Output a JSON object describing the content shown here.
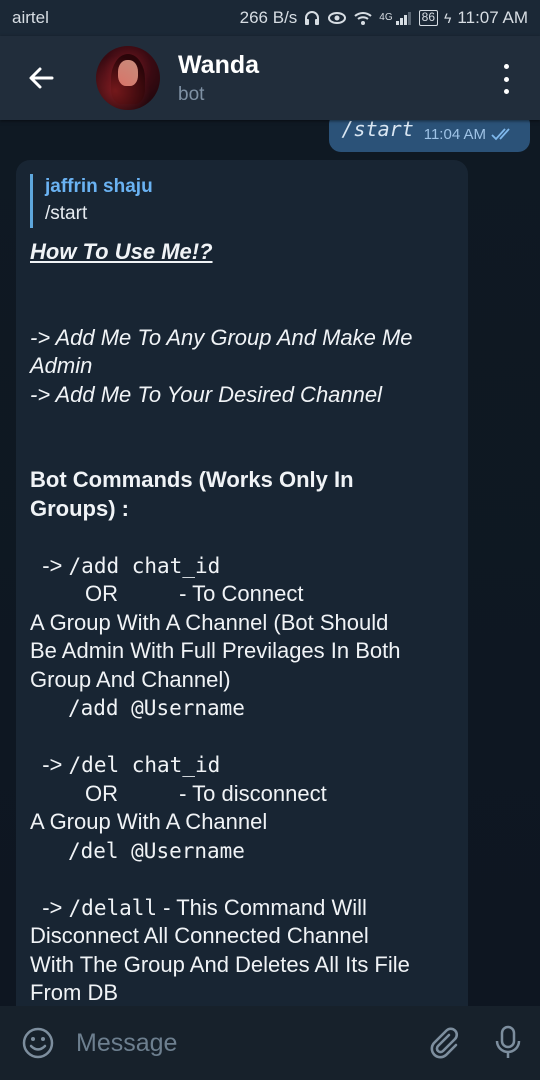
{
  "status_bar": {
    "carrier": "airtel",
    "speed": "266 B/s",
    "network": "4G",
    "battery": "86",
    "time": "11:07 AM"
  },
  "header": {
    "title": "Wanda",
    "subtitle": "bot"
  },
  "outgoing": {
    "text": "/start",
    "time": "11:04 AM"
  },
  "incoming": {
    "reply_name": "jaffrin shaju",
    "reply_text": "/start",
    "heading": "How To Use Me!?",
    "lines": {
      "add_group_1": "-> Add Me To Any Group And Make Me",
      "add_group_2": "Admin",
      "add_channel": "-> Add Me To Your Desired Channel",
      "commands_title_1": "Bot Commands (Works Only In",
      "commands_title_2": "Groups) :",
      "add_arrow": "  -> ",
      "add_cmd": "/add chat_id",
      "add_or": "         OR",
      "add_desc_a": "          - To Connect",
      "add_desc_1": "A Group With A Channel (Bot Should",
      "add_desc_2": "Be Admin With Full Previlages In Both",
      "add_desc_3": "Group And Channel)",
      "add_username": "   /add @Username",
      "del_arrow": "  -> ",
      "del_cmd": "/del chat_id",
      "del_or": "         OR",
      "del_desc_a": "          - To disconnect",
      "del_desc_1": "A Group With A Channel",
      "del_username": "   /del @Username",
      "delall_arrow": "  -> ",
      "delall_cmd": "/delall",
      "delall_desc_a": " - This Command Will",
      "delall_desc_1": "Disconnect All Connected Channel",
      "delall_desc_2": "With The Group And Deletes All Its File",
      "delall_desc_3": "From DB"
    }
  },
  "input": {
    "placeholder": "Message"
  },
  "colors": {
    "background": "#0e1621",
    "header": "#212d3b",
    "outgoing_bubble": "#2b5278",
    "incoming_bubble": "#182533",
    "accent": "#6ab2f2"
  }
}
